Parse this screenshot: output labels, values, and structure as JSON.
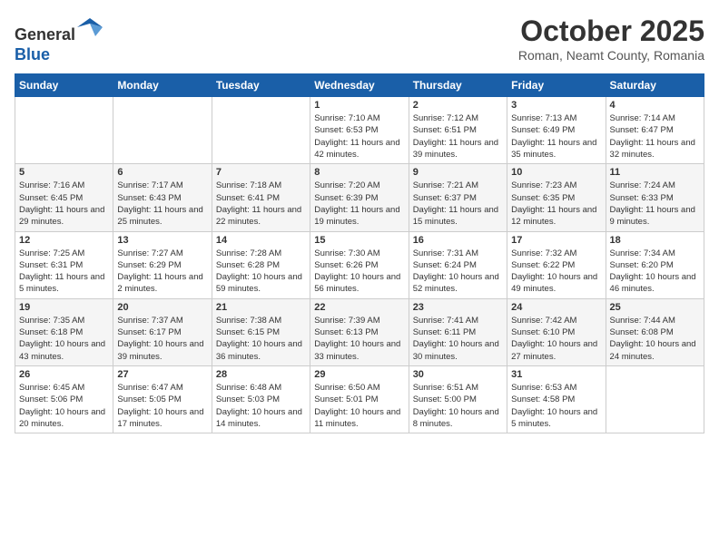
{
  "header": {
    "logo_line1": "General",
    "logo_line2": "Blue",
    "month": "October 2025",
    "location": "Roman, Neamt County, Romania"
  },
  "weekdays": [
    "Sunday",
    "Monday",
    "Tuesday",
    "Wednesday",
    "Thursday",
    "Friday",
    "Saturday"
  ],
  "weeks": [
    [
      {
        "day": "",
        "info": ""
      },
      {
        "day": "",
        "info": ""
      },
      {
        "day": "",
        "info": ""
      },
      {
        "day": "1",
        "info": "Sunrise: 7:10 AM\nSunset: 6:53 PM\nDaylight: 11 hours\nand 42 minutes."
      },
      {
        "day": "2",
        "info": "Sunrise: 7:12 AM\nSunset: 6:51 PM\nDaylight: 11 hours\nand 39 minutes."
      },
      {
        "day": "3",
        "info": "Sunrise: 7:13 AM\nSunset: 6:49 PM\nDaylight: 11 hours\nand 35 minutes."
      },
      {
        "day": "4",
        "info": "Sunrise: 7:14 AM\nSunset: 6:47 PM\nDaylight: 11 hours\nand 32 minutes."
      }
    ],
    [
      {
        "day": "5",
        "info": "Sunrise: 7:16 AM\nSunset: 6:45 PM\nDaylight: 11 hours\nand 29 minutes."
      },
      {
        "day": "6",
        "info": "Sunrise: 7:17 AM\nSunset: 6:43 PM\nDaylight: 11 hours\nand 25 minutes."
      },
      {
        "day": "7",
        "info": "Sunrise: 7:18 AM\nSunset: 6:41 PM\nDaylight: 11 hours\nand 22 minutes."
      },
      {
        "day": "8",
        "info": "Sunrise: 7:20 AM\nSunset: 6:39 PM\nDaylight: 11 hours\nand 19 minutes."
      },
      {
        "day": "9",
        "info": "Sunrise: 7:21 AM\nSunset: 6:37 PM\nDaylight: 11 hours\nand 15 minutes."
      },
      {
        "day": "10",
        "info": "Sunrise: 7:23 AM\nSunset: 6:35 PM\nDaylight: 11 hours\nand 12 minutes."
      },
      {
        "day": "11",
        "info": "Sunrise: 7:24 AM\nSunset: 6:33 PM\nDaylight: 11 hours\nand 9 minutes."
      }
    ],
    [
      {
        "day": "12",
        "info": "Sunrise: 7:25 AM\nSunset: 6:31 PM\nDaylight: 11 hours\nand 5 minutes."
      },
      {
        "day": "13",
        "info": "Sunrise: 7:27 AM\nSunset: 6:29 PM\nDaylight: 11 hours\nand 2 minutes."
      },
      {
        "day": "14",
        "info": "Sunrise: 7:28 AM\nSunset: 6:28 PM\nDaylight: 10 hours\nand 59 minutes."
      },
      {
        "day": "15",
        "info": "Sunrise: 7:30 AM\nSunset: 6:26 PM\nDaylight: 10 hours\nand 56 minutes."
      },
      {
        "day": "16",
        "info": "Sunrise: 7:31 AM\nSunset: 6:24 PM\nDaylight: 10 hours\nand 52 minutes."
      },
      {
        "day": "17",
        "info": "Sunrise: 7:32 AM\nSunset: 6:22 PM\nDaylight: 10 hours\nand 49 minutes."
      },
      {
        "day": "18",
        "info": "Sunrise: 7:34 AM\nSunset: 6:20 PM\nDaylight: 10 hours\nand 46 minutes."
      }
    ],
    [
      {
        "day": "19",
        "info": "Sunrise: 7:35 AM\nSunset: 6:18 PM\nDaylight: 10 hours\nand 43 minutes."
      },
      {
        "day": "20",
        "info": "Sunrise: 7:37 AM\nSunset: 6:17 PM\nDaylight: 10 hours\nand 39 minutes."
      },
      {
        "day": "21",
        "info": "Sunrise: 7:38 AM\nSunset: 6:15 PM\nDaylight: 10 hours\nand 36 minutes."
      },
      {
        "day": "22",
        "info": "Sunrise: 7:39 AM\nSunset: 6:13 PM\nDaylight: 10 hours\nand 33 minutes."
      },
      {
        "day": "23",
        "info": "Sunrise: 7:41 AM\nSunset: 6:11 PM\nDaylight: 10 hours\nand 30 minutes."
      },
      {
        "day": "24",
        "info": "Sunrise: 7:42 AM\nSunset: 6:10 PM\nDaylight: 10 hours\nand 27 minutes."
      },
      {
        "day": "25",
        "info": "Sunrise: 7:44 AM\nSunset: 6:08 PM\nDaylight: 10 hours\nand 24 minutes."
      }
    ],
    [
      {
        "day": "26",
        "info": "Sunrise: 6:45 AM\nSunset: 5:06 PM\nDaylight: 10 hours\nand 20 minutes."
      },
      {
        "day": "27",
        "info": "Sunrise: 6:47 AM\nSunset: 5:05 PM\nDaylight: 10 hours\nand 17 minutes."
      },
      {
        "day": "28",
        "info": "Sunrise: 6:48 AM\nSunset: 5:03 PM\nDaylight: 10 hours\nand 14 minutes."
      },
      {
        "day": "29",
        "info": "Sunrise: 6:50 AM\nSunset: 5:01 PM\nDaylight: 10 hours\nand 11 minutes."
      },
      {
        "day": "30",
        "info": "Sunrise: 6:51 AM\nSunset: 5:00 PM\nDaylight: 10 hours\nand 8 minutes."
      },
      {
        "day": "31",
        "info": "Sunrise: 6:53 AM\nSunset: 4:58 PM\nDaylight: 10 hours\nand 5 minutes."
      },
      {
        "day": "",
        "info": ""
      }
    ]
  ]
}
